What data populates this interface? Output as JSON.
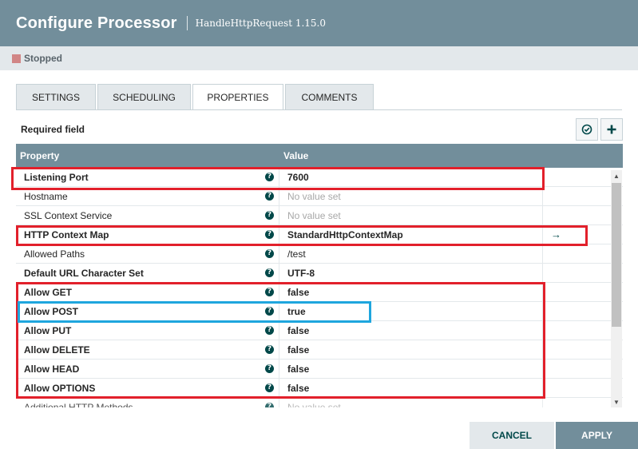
{
  "dialog": {
    "title": "Configure Processor",
    "subtitle": "HandleHttpRequest 1.15.0",
    "status": "Stopped"
  },
  "tabs": [
    {
      "label": "SETTINGS"
    },
    {
      "label": "SCHEDULING"
    },
    {
      "label": "PROPERTIES"
    },
    {
      "label": "COMMENTS"
    }
  ],
  "active_tab": "PROPERTIES",
  "required_field_label": "Required field",
  "table": {
    "headers": {
      "property": "Property",
      "value": "Value"
    },
    "rows": [
      {
        "name": "Listening Port",
        "value": "7600",
        "required": true,
        "empty": false
      },
      {
        "name": "Hostname",
        "value": "No value set",
        "required": false,
        "empty": true
      },
      {
        "name": "SSL Context Service",
        "value": "No value set",
        "required": false,
        "empty": true
      },
      {
        "name": "HTTP Context Map",
        "value": "StandardHttpContextMap",
        "required": true,
        "empty": false,
        "action": "→"
      },
      {
        "name": "Allowed Paths",
        "value": "/test",
        "required": false,
        "empty": false
      },
      {
        "name": "Default URL Character Set",
        "value": "UTF-8",
        "required": true,
        "empty": false
      },
      {
        "name": "Allow GET",
        "value": "false",
        "required": true,
        "empty": false
      },
      {
        "name": "Allow POST",
        "value": "true",
        "required": true,
        "empty": false
      },
      {
        "name": "Allow PUT",
        "value": "false",
        "required": true,
        "empty": false
      },
      {
        "name": "Allow DELETE",
        "value": "false",
        "required": true,
        "empty": false
      },
      {
        "name": "Allow HEAD",
        "value": "false",
        "required": true,
        "empty": false
      },
      {
        "name": "Allow OPTIONS",
        "value": "false",
        "required": true,
        "empty": false
      },
      {
        "name": "Additional HTTP Methods",
        "value": "No value set",
        "required": false,
        "empty": true
      }
    ]
  },
  "footer": {
    "cancel_label": "CANCEL",
    "apply_label": "APPLY"
  },
  "colors": {
    "header_bg": "#728e9b",
    "highlight_red": "#e2202b",
    "highlight_blue": "#1ea6de",
    "status_stopped": "#d18686"
  }
}
